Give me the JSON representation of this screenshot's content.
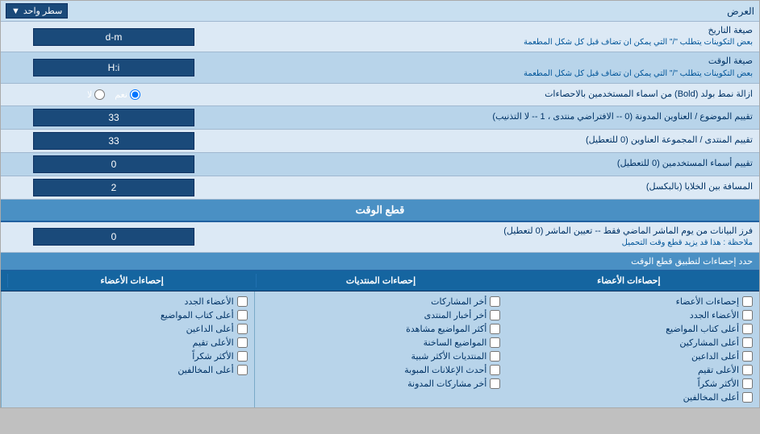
{
  "header": {
    "label": "العرض",
    "dropdown_label": "سطر واحد"
  },
  "rows": [
    {
      "id": "date-format",
      "label": "صيغة التاريخ",
      "sub_label": "بعض التكوينات يتطلب \"/\" التي يمكن ان تضاف قبل كل شكل المطعمة",
      "value": "d-m",
      "alt": false
    },
    {
      "id": "time-format",
      "label": "صيغة الوقت",
      "sub_label": "بعض التكوينات يتطلب \"/\" التي يمكن ان تضاف قبل كل شكل المطعمة",
      "value": "H:i",
      "alt": true
    },
    {
      "id": "bold-remove",
      "label": "ازالة نمط بولد (Bold) من اسماء المستخدمين بالاحصاءات",
      "type": "radio",
      "options": [
        {
          "label": "نعم",
          "selected": true
        },
        {
          "label": "لا",
          "selected": false
        }
      ],
      "alt": false
    },
    {
      "id": "topic-sort",
      "label": "تقييم الموضوع / العناوين المدونة (0 -- الافتراضي منتدى ، 1 -- لا التذنيب)",
      "value": "33",
      "alt": true
    },
    {
      "id": "forum-sort",
      "label": "تقييم المنتدى / المجموعة العناوين (0 للتعطيل)",
      "value": "33",
      "alt": false
    },
    {
      "id": "user-names",
      "label": "تقييم أسماء المستخدمين (0 للتعطيل)",
      "value": "0",
      "alt": true
    },
    {
      "id": "gap",
      "label": "المسافة بين الخلايا (بالبكسل)",
      "value": "2",
      "alt": false
    }
  ],
  "section_cutoff": {
    "title": "قطع الوقت",
    "row": {
      "label": "فرز البيانات من يوم الماشر الماضي فقط -- تعيين الماشر (0 لتعطيل)",
      "note": "ملاحظة : هذا قد يزيد قطع وقت التحميل",
      "value": "0"
    }
  },
  "stats_section": {
    "limit_label": "حدد إحصاءات لتطبيق قطع الوقت",
    "columns": [
      {
        "header": "إحصاءات الأعضاء",
        "items": [
          {
            "label": "الأعضاء الجدد",
            "checked": false
          },
          {
            "label": "أعلى كتاب المواضيع",
            "checked": false
          },
          {
            "label": "أعلى الداعين",
            "checked": false
          },
          {
            "label": "الأعلى تقيم",
            "checked": false
          },
          {
            "label": "الأكثر شكراً",
            "checked": false
          },
          {
            "label": "أعلى المخالفين",
            "checked": false
          }
        ]
      },
      {
        "header": "إحصاءات المنتديات",
        "items": [
          {
            "label": "أخر المشاركات",
            "checked": false
          },
          {
            "label": "أخر أخبار المنتدى",
            "checked": false
          },
          {
            "label": "أكثر المواضيع مشاهدة",
            "checked": false
          },
          {
            "label": "المواضيع الساخنة",
            "checked": false
          },
          {
            "label": "المنتديات الأكثر شبية",
            "checked": false
          },
          {
            "label": "أحدث الإعلانات المبوبة",
            "checked": false
          },
          {
            "label": "أخر مشاركات المدونة",
            "checked": false
          }
        ]
      },
      {
        "header": "إحصاءات الأعضاء",
        "items": [
          {
            "label": "إحصاءات الأعضاء",
            "checked": false
          },
          {
            "label": "الأعضاء الجدد",
            "checked": false
          },
          {
            "label": "أعلى كتاب المواضيع",
            "checked": false
          },
          {
            "label": "أعلى المشاركين",
            "checked": false
          },
          {
            "label": "أعلى الداعين",
            "checked": false
          },
          {
            "label": "الأعلى تقيم",
            "checked": false
          },
          {
            "label": "الأكثر شكراً",
            "checked": false
          },
          {
            "label": "أعلى المخالفين",
            "checked": false
          }
        ]
      }
    ]
  }
}
